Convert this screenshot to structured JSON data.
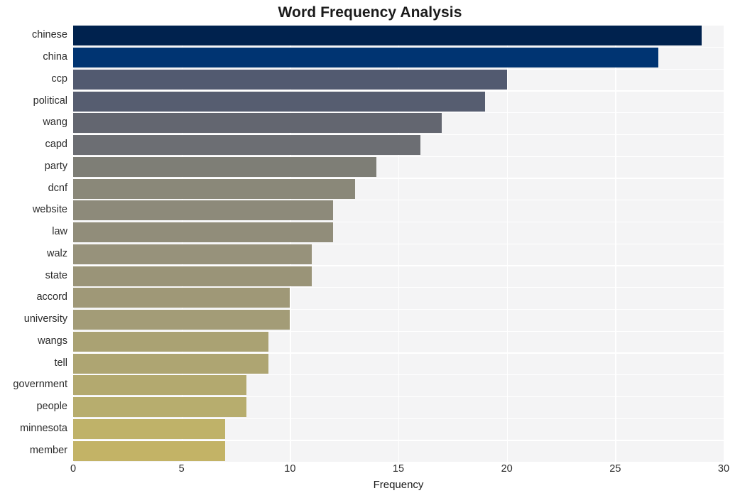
{
  "chart_data": {
    "type": "bar",
    "orientation": "horizontal",
    "title": "Word Frequency Analysis",
    "xlabel": "Frequency",
    "ylabel": "",
    "xlim": [
      0,
      30
    ],
    "xticks": [
      0,
      5,
      10,
      15,
      20,
      25,
      30
    ],
    "grid": true,
    "legend": "none",
    "categories": [
      "chinese",
      "china",
      "ccp",
      "political",
      "wang",
      "capd",
      "party",
      "dcnf",
      "website",
      "law",
      "walz",
      "state",
      "accord",
      "university",
      "wangs",
      "tell",
      "government",
      "people",
      "minnesota",
      "member"
    ],
    "values": [
      29,
      27,
      20,
      19,
      17,
      16,
      14,
      13,
      12,
      12,
      11,
      11,
      10,
      10,
      9,
      9,
      8,
      8,
      7,
      7
    ],
    "bar_colors": [
      "#00224e",
      "#003472",
      "#525a70",
      "#565d70",
      "#636670",
      "#6c6e73",
      "#7e7e76",
      "#888madeup",
      "#8d8a7a",
      "#918d7a",
      "#97927b",
      "#9a9478",
      "#9f9877",
      "#a39c77",
      "#aaa273",
      "#aea572",
      "#b3a96f",
      "#b7ad6e",
      "#bfb269",
      "#c3b366"
    ],
    "plot_background": "#f4f4f5",
    "gridline_color": "#ffffff",
    "figure_background": "#ffffff"
  }
}
